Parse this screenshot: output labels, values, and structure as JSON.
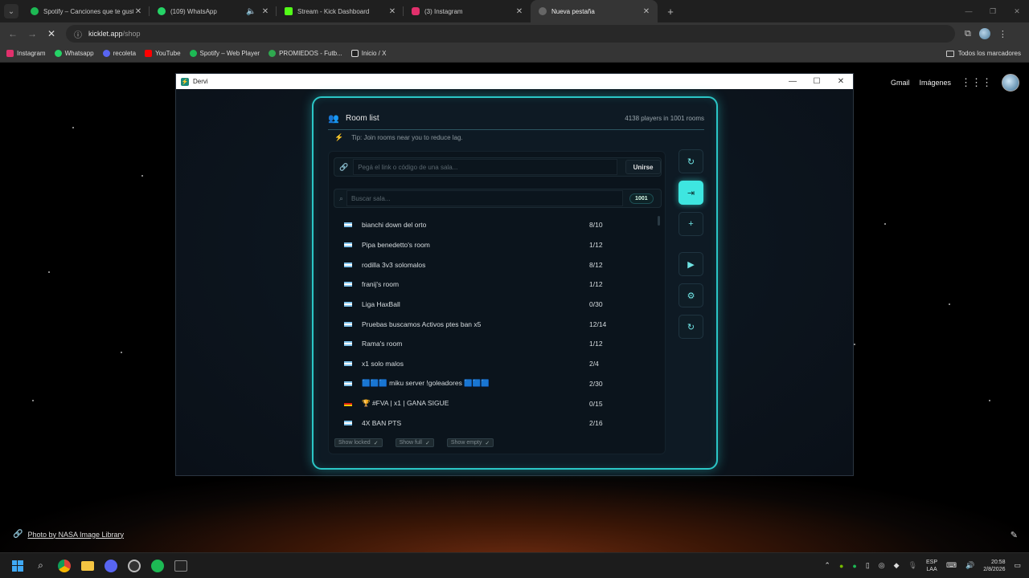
{
  "browser": {
    "tabs": [
      {
        "label": "Spotify – Canciones que te gust",
        "color": "#1db954",
        "active": false
      },
      {
        "label": "(109) WhatsApp",
        "color": "#25d366",
        "active": false
      },
      {
        "label": "Stream - Kick Dashboard",
        "color": "#53fc18",
        "active": false
      },
      {
        "label": "(3) Instagram",
        "color": "#e1306c",
        "active": false
      },
      {
        "label": "Nueva pestaña",
        "color": "#888888",
        "active": true
      }
    ],
    "url_host": "kicklet.app",
    "url_path": "/shop",
    "bookmarks": [
      {
        "label": "Instagram",
        "color": "#e1306c"
      },
      {
        "label": "Whatsapp",
        "color": "#25d366"
      },
      {
        "label": "recoleta",
        "color": "#5865f2"
      },
      {
        "label": "YouTube",
        "color": "#ff0000"
      },
      {
        "label": "Spotify – Web Player",
        "color": "#1db954"
      },
      {
        "label": "PROMIEDOS - Futb...",
        "color": "#2fa84f"
      },
      {
        "label": "Inicio / X",
        "color": "#dddddd"
      }
    ],
    "all_bookmarks": "Todos los marcadores"
  },
  "newtab": {
    "gmail": "Gmail",
    "images": "Imágenes",
    "credit": "Photo by NASA Image Library"
  },
  "app": {
    "window_title": "Dervi",
    "panel_title": "Room list",
    "stats": "4138 players in 1001 rooms",
    "tip": "Tip: Join rooms near you to reduce lag.",
    "join_placeholder": "Pegá el link o código de una sala...",
    "join_button": "Unirse",
    "search_placeholder": "Buscar sala...",
    "room_count": "1001",
    "rooms": [
      {
        "name": "bianchi down del orto",
        "players": "8/10",
        "flag": "ar"
      },
      {
        "name": "Pipa benedetto's room",
        "players": "1/12",
        "flag": "ar"
      },
      {
        "name": "rodilla 3v3 solomalos",
        "players": "8/12",
        "flag": "ar"
      },
      {
        "name": "franij's room",
        "players": "1/12",
        "flag": "ar"
      },
      {
        "name": "Liga HaxBall",
        "players": "0/30",
        "flag": "ar"
      },
      {
        "name": "Pruebas buscamos Activos ptes ban x5",
        "players": "12/14",
        "flag": "ar"
      },
      {
        "name": "Rama's room",
        "players": "1/12",
        "flag": "ar"
      },
      {
        "name": "x1 solo malos",
        "players": "2/4",
        "flag": "ar"
      },
      {
        "name": "🟦🟦🟦 miku server !goleadores 🟦🟦🟦",
        "players": "2/30",
        "flag": "ar"
      },
      {
        "name": "🏆 #FVA | x1 | GANA SIGUE",
        "players": "0/15",
        "flag": "de"
      },
      {
        "name": "4X BAN PTS",
        "players": "2/16",
        "flag": "ar"
      }
    ],
    "filters": [
      "Show locked",
      "Show full",
      "Show empty"
    ]
  },
  "taskbar": {
    "lang": "ESP",
    "lang_sub": "LAA",
    "time": "20:58",
    "date": "2/8/2026"
  }
}
